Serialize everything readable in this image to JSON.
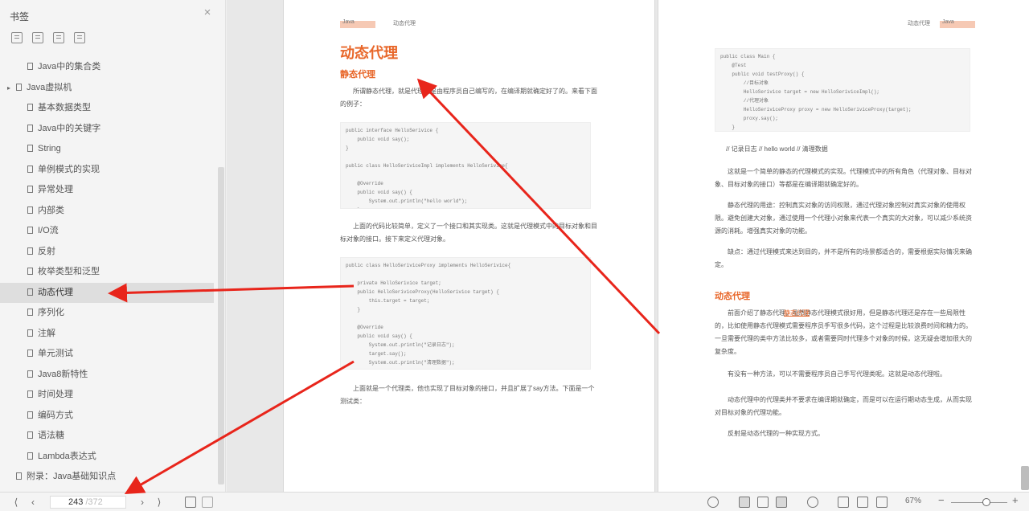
{
  "sidebar": {
    "title": "书签",
    "close": "×",
    "items": [
      {
        "label": "Java中的集合类",
        "level": 2
      },
      {
        "label": "Java虚拟机",
        "level": 1,
        "caret": "▸"
      },
      {
        "label": "基本数据类型",
        "level": 2
      },
      {
        "label": "Java中的关键字",
        "level": 2
      },
      {
        "label": "String",
        "level": 2
      },
      {
        "label": "单例模式的实现",
        "level": 2
      },
      {
        "label": "异常处理",
        "level": 2
      },
      {
        "label": "内部类",
        "level": 2
      },
      {
        "label": "I/O流",
        "level": 2
      },
      {
        "label": "反射",
        "level": 2
      },
      {
        "label": "枚举类型和泛型",
        "level": 2
      },
      {
        "label": "动态代理",
        "level": 2,
        "active": true
      },
      {
        "label": "序列化",
        "level": 2
      },
      {
        "label": "注解",
        "level": 2
      },
      {
        "label": "单元测试",
        "level": 2
      },
      {
        "label": "Java8新特性",
        "level": 2
      },
      {
        "label": "时间处理",
        "level": 2
      },
      {
        "label": "编码方式",
        "level": 2
      },
      {
        "label": "语法糖",
        "level": 2
      },
      {
        "label": "Lambda表达式",
        "level": 2
      },
      {
        "label": "附录：Java基础知识点",
        "level": 1
      }
    ]
  },
  "left_page": {
    "header_tag": "Java",
    "header_text": "动态代理",
    "title": "动态代理",
    "subtitle": "静态代理",
    "para1": "所谓静态代理，就是代理类是由程序员自己编写的，在编译期就确定好了的。来看下面的例子：",
    "code1": "public interface HelloSerivice {\n    public void say();\n}\n\npublic class HelloSeriviceImpl implements HelloSerivice{\n\n    @Override\n    public void say() {\n        System.out.println(\"hello world\");\n    }\n}",
    "para2": "上面的代码比较简单，定义了一个接口和其实现类。这就是代理模式中的目标对象和目标对象的接口。接下来定义代理对象。",
    "code2": "public class HelloSeriviceProxy implements HelloSerivice{\n\n    private HelloSerivice target;\n    public HelloSeriviceProxy(HelloSerivice target) {\n        this.target = target;\n    }\n\n    @Override\n    public void say() {\n        System.out.println(\"记录日志\");\n        target.say();\n        System.out.println(\"清理数据\");\n    }\n}",
    "para3": "上面就是一个代理类，他也实现了目标对象的接口，并且扩展了say方法。下面是一个测试类："
  },
  "right_page": {
    "header_text": "动态代理",
    "header_tag": "Java",
    "code": "public class Main {\n    @Test\n    public void testProxy() {\n        //目标对象\n        HelloSerivice target = new HelloSeriviceImpl();\n        //代理对象\n        HelloSeriviceProxy proxy = new HelloSeriviceProxy(target);\n        proxy.say();\n    }\n}",
    "note": "// 记录日志 // hello world // 清理数据",
    "para1": "这就是一个简单的静态的代理模式的实现。代理模式中的所有角色（代理对象、目标对象、目标对象的接口）等都是在编译期就确定好的。",
    "para2": "静态代理的用途：控制真实对象的访问权限，通过代理对象控制对真实对象的使用权限。避免创建大对象，通过使用一个代理小对象来代表一个真实的大对象，可以减少系统资源的消耗。增强真实对象的功能。",
    "para3": "缺点：通过代理模式来达到目的，并不是所有的场景都适合的，需要根据实际情况来确定。",
    "subtitle": "动态代理",
    "para4": "前面介绍了静态代理，虽然静态代理模式很好用，但是静态代理还是存在一些局限性的，比如使用静态代理模式需要程序员手写很多代码，这个过程是比较浪费时间和精力的。一旦需要代理的类中方法比较多，或者需要同时代理多个对象的时候，这无疑会增加很大的复杂度。",
    "para5": "有没有一种方法，可以不需要程序员自己手写代理类呢。这就是动态代理啦。",
    "para6": "动态代理中的代理类并不要求在编译期就确定，而是可以在运行期动态生成，从而实现对目标对象的代理功能。",
    "para7": "反射是动态代理的一种实现方式。",
    "link": "静态代理"
  },
  "bottom_bar": {
    "first": "⟨",
    "prev": "‹",
    "page_current": "243",
    "page_total": "/372",
    "next": "›",
    "last": "⟩",
    "zoom": "67%",
    "zoom_minus": "−",
    "zoom_plus": "+"
  },
  "annotation_color": "#e8251b"
}
